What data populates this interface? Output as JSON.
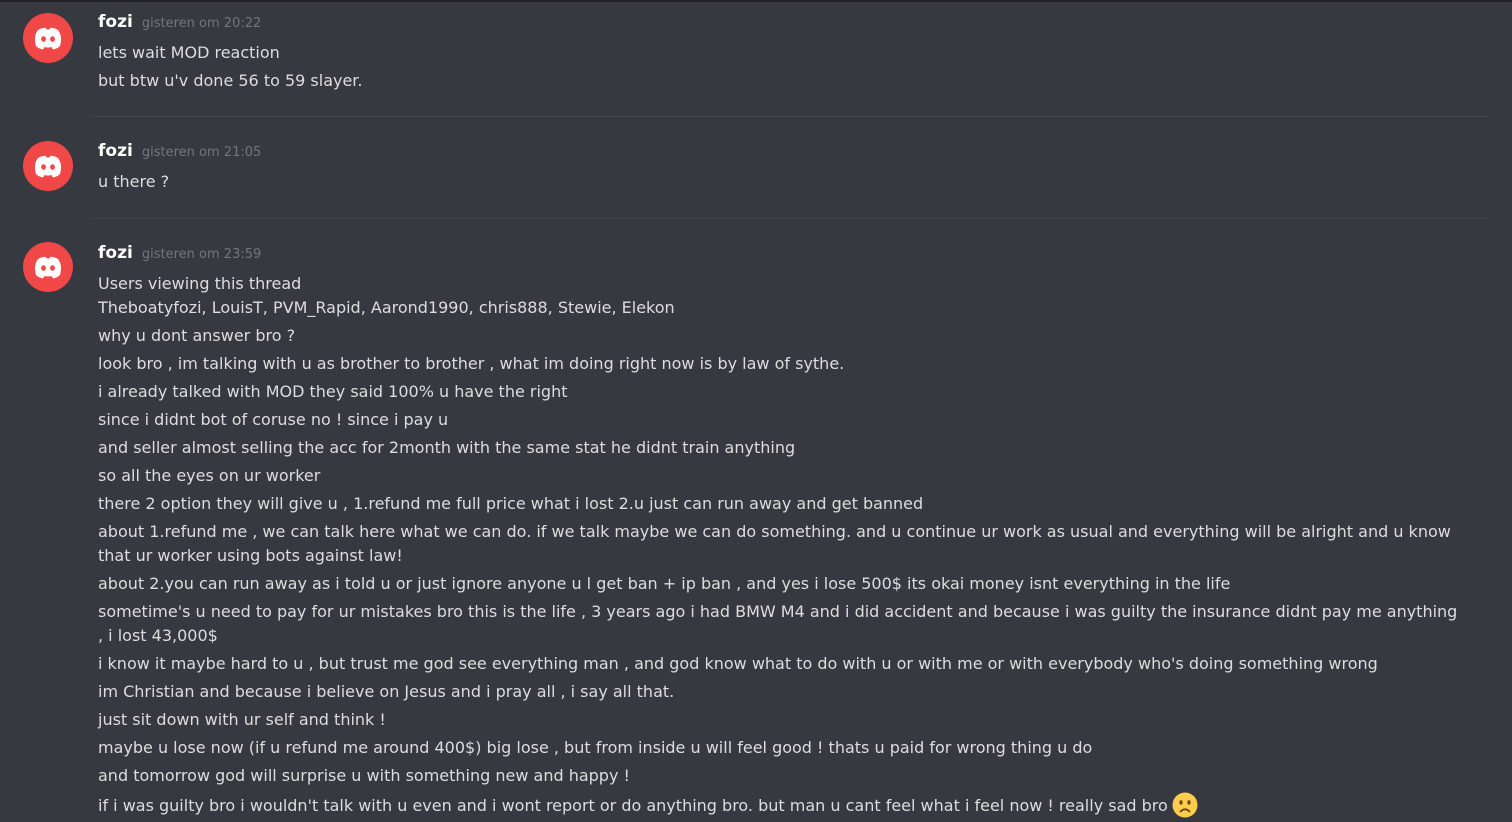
{
  "messages": [
    {
      "username": "fozi",
      "timestamp": "gisteren om 20:22",
      "lines": [
        "lets wait MOD reaction",
        "but btw u'v done 56 to 59 slayer."
      ]
    },
    {
      "username": "fozi",
      "timestamp": "gisteren om 21:05",
      "lines": [
        "u there ?"
      ]
    },
    {
      "username": "fozi",
      "timestamp": "gisteren om 23:59",
      "lines": [
        "Users viewing this thread",
        "Theboatyfozi, LouisT, PVM_Rapid, Aarond1990, chris888, Stewie, Elekon",
        "why u dont answer bro ?",
        "look bro , im talking with u as brother to brother , what im doing right now is by law of sythe.",
        "i already talked with MOD they said 100% u have the right",
        "since i didnt bot of coruse no ! since i pay u",
        "and seller almost selling the acc for 2month with the same stat he didnt train anything",
        "so all the eyes on ur worker",
        "there 2 option they will give u , 1.refund me full price what i lost 2.u just can run away and get banned",
        "about 1.refund me , we can talk here what we can do. if we talk maybe we can do something. and u continue ur work as usual and everything will be alright and u know that ur worker using bots against law!",
        "about 2.you can run away as i told u or just ignore anyone u l get ban + ip ban , and yes i lose 500$ its okai money isnt everything in the life",
        "sometime's u need to pay for ur mistakes bro this is the life , 3 years ago i had BMW M4 and i did accident and because i was guilty the insurance didnt pay me anything , i lost 43,000$",
        "i know it maybe hard to u , but trust me god see everything man , and god know what to do with u or with me or with everybody who's doing something wrong",
        "im Christian and because i believe on Jesus and i pray all , i say all that.",
        "just sit down with ur self and think !",
        "maybe u lose now (if u refund me around 400$) big lose , but from inside u will feel good ! thats u paid for wrong thing u do",
        "and tomorrow god will surprise u with something new and happy !",
        "if i was guilty bro i wouldn't talk with u even and i wont report or do anything bro. but man u cant feel what i feel now ! really sad bro"
      ],
      "trailing_emoji": "frowning-face-emoji"
    }
  ],
  "colors": {
    "background": "#36393f",
    "avatar": "#f04747",
    "username": "#ffffff",
    "timestamp": "#72767d",
    "message_text": "#dcddde",
    "divider": "#42454a"
  }
}
